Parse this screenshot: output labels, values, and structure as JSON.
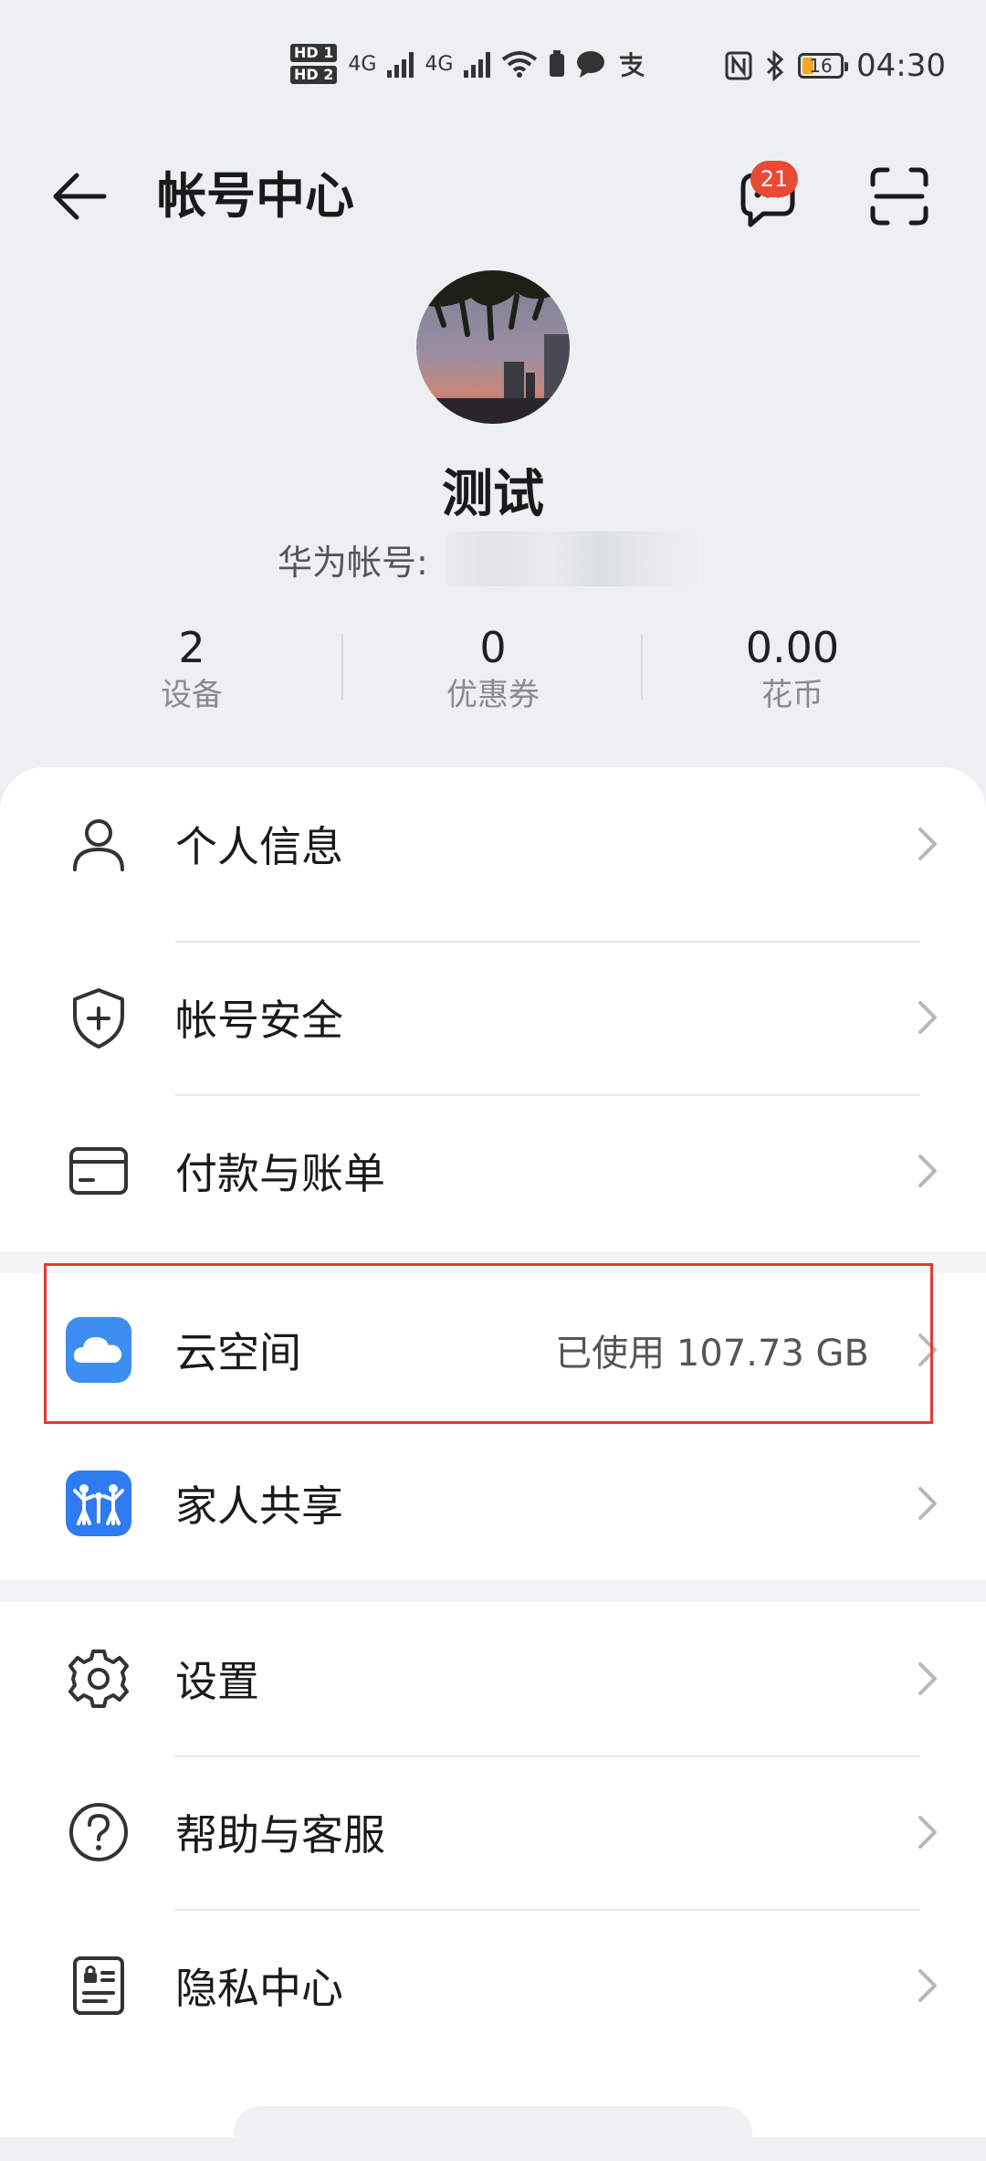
{
  "status_bar": {
    "hd1": "HD 1",
    "hd2": "HD 2",
    "net1": "4G",
    "net2": "4G",
    "battery": "16",
    "time": "04:30"
  },
  "header": {
    "title": "帐号中心",
    "message_count": "21"
  },
  "profile": {
    "name": "测试",
    "account_label": "华为帐号:"
  },
  "stats": [
    {
      "value": "2",
      "label": "设备"
    },
    {
      "value": "0",
      "label": "优惠券"
    },
    {
      "value": "0.00",
      "label": "花币"
    }
  ],
  "menu": {
    "personal_info": "个人信息",
    "account_security": "帐号安全",
    "payment_billing": "付款与账单",
    "cloud_space": "云空间",
    "cloud_usage": "已使用 107.73 GB",
    "family_sharing": "家人共享",
    "settings": "设置",
    "help": "帮助与客服",
    "privacy": "隐私中心"
  },
  "colors": {
    "background": "#ecf0f3",
    "badge": "#e84a36",
    "highlight": "#e53935",
    "cloud_icon": "#3d8ef0",
    "family_icon": "#2f7cf0"
  }
}
